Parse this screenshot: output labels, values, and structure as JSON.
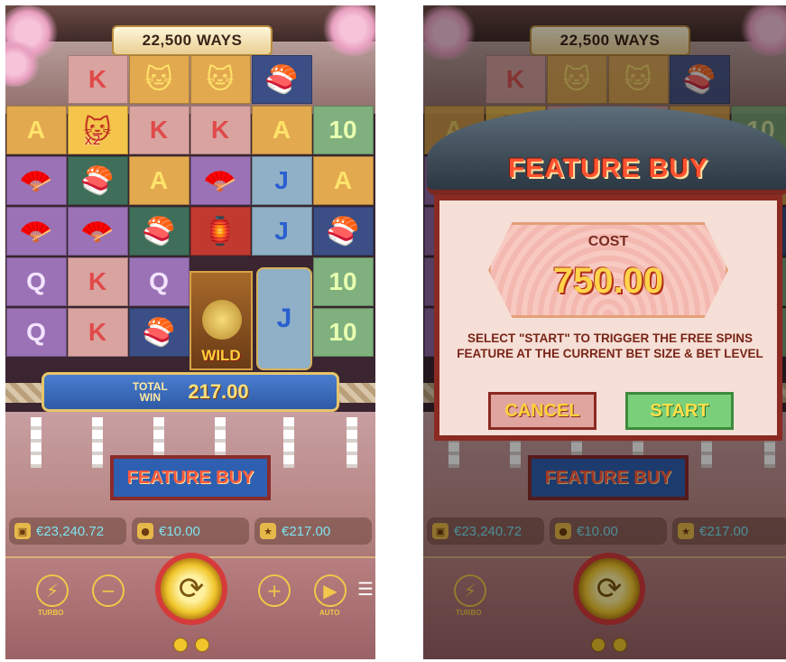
{
  "left": {
    "ways_label": "22,500 WAYS",
    "grid": [
      [
        {
          "t": "",
          "c": "c-empty"
        },
        {
          "t": "K",
          "c": "c-pink"
        },
        {
          "t": "🐱",
          "c": "c-orange"
        },
        {
          "t": "🐱",
          "c": "c-orange"
        },
        {
          "t": "🍣",
          "c": "c-navy"
        },
        {
          "t": "",
          "c": "c-empty"
        }
      ],
      [
        {
          "t": "A",
          "c": "c-orange"
        },
        {
          "t": "🐱",
          "c": "c-gold"
        },
        {
          "t": "K",
          "c": "c-pink"
        },
        {
          "t": "K",
          "c": "c-pink"
        },
        {
          "t": "A",
          "c": "c-orange"
        },
        {
          "t": "10",
          "c": "c-green"
        }
      ],
      [
        {
          "t": "🪭",
          "c": "c-purple"
        },
        {
          "t": "🍣",
          "c": "c-dgreen"
        },
        {
          "t": "A",
          "c": "c-orange"
        },
        {
          "t": "🪭",
          "c": "c-purple"
        },
        {
          "t": "J",
          "c": "c-lblue"
        },
        {
          "t": "A",
          "c": "c-orange"
        }
      ],
      [
        {
          "t": "🪭",
          "c": "c-purple"
        },
        {
          "t": "🪭",
          "c": "c-purple"
        },
        {
          "t": "🍣",
          "c": "c-dgreen"
        },
        {
          "t": "🏮",
          "c": "c-red"
        },
        {
          "t": "J",
          "c": "c-lblue"
        },
        {
          "t": "🍣",
          "c": "c-navy"
        }
      ],
      [
        {
          "t": "Q",
          "c": "c-purple"
        },
        {
          "t": "K",
          "c": "c-pink"
        },
        {
          "t": "Q",
          "c": "c-purple"
        },
        {
          "t": "",
          "c": "c-empty"
        },
        {
          "t": "",
          "c": "c-empty"
        },
        {
          "t": "10",
          "c": "c-green"
        }
      ],
      [
        {
          "t": "Q",
          "c": "c-purple"
        },
        {
          "t": "K",
          "c": "c-pink"
        },
        {
          "t": "🍣",
          "c": "c-navy"
        },
        {
          "t": "",
          "c": "c-empty"
        },
        {
          "t": "",
          "c": "c-empty"
        },
        {
          "t": "10",
          "c": "c-green"
        }
      ]
    ],
    "multiplier": "x2",
    "wild_label": "WILD",
    "big_symbol": "J",
    "total_win_label_1": "TOTAL",
    "total_win_label_2": "WIN",
    "total_win_value": "217.00",
    "feature_buy_label": "FEATURE BUY",
    "balance": "€23,240.72",
    "bet": "€10.00",
    "win": "€217.00",
    "turbo_label": "TURBO",
    "auto_label": "AUTO"
  },
  "right": {
    "ways_label": "22,500 WAYS",
    "modal_title": "FEATURE BUY",
    "cost_label": "COST",
    "cost_value": "750.00",
    "description": "SELECT \"START\" TO TRIGGER THE FREE SPINS FEATURE AT THE CURRENT BET SIZE & BET LEVEL",
    "cancel_label": "CANCEL",
    "start_label": "START",
    "feature_buy_label": "FEATURE BUY",
    "balance": "€23,240.72",
    "bet": "€10.00",
    "win": "€217.00",
    "turbo_label": "TURBO"
  },
  "icons": {
    "turbo": "lightning-icon",
    "minus": "minus-icon",
    "plus": "plus-icon",
    "auto": "play-icon",
    "menu": "menu-icon",
    "spin": "spin-arrows-icon",
    "wallet": "wallet-icon",
    "coins": "coins-icon",
    "win": "win-badge-icon"
  },
  "colors": {
    "accent_gold": "#f2c74a",
    "balance_text": "#7de3ee",
    "title_red": "#ff5230"
  }
}
